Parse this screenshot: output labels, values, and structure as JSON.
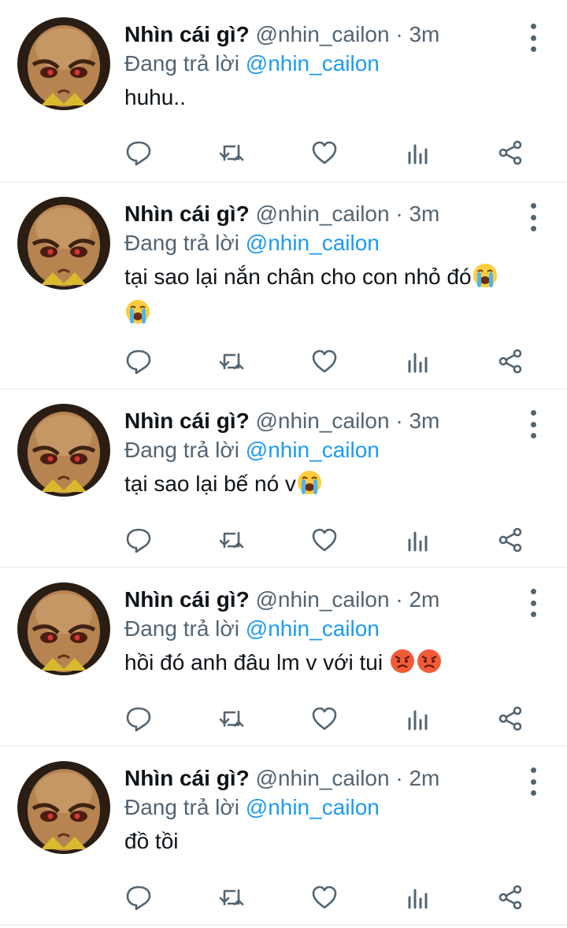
{
  "tweets": [
    {
      "name": "Nhìn cái gì?",
      "handle": "@nhin_cailon",
      "separator": "·",
      "time": "3m",
      "reply_prefix": "Đang trả lời",
      "reply_to": "@nhin_cailon",
      "text": "huhu..",
      "emojis": []
    },
    {
      "name": "Nhìn cái gì?",
      "handle": "@nhin_cailon",
      "separator": "·",
      "time": "3m",
      "reply_prefix": "Đang trả lời",
      "reply_to": "@nhin_cailon",
      "text": "tại sao lại nắn chân cho con nhỏ đó",
      "emojis": [
        "loudly-crying-face",
        "loudly-crying-face"
      ]
    },
    {
      "name": "Nhìn cái gì?",
      "handle": "@nhin_cailon",
      "separator": "·",
      "time": "3m",
      "reply_prefix": "Đang trả lời",
      "reply_to": "@nhin_cailon",
      "text": "tại sao lại bế nó v",
      "emojis": [
        "loudly-crying-face"
      ]
    },
    {
      "name": "Nhìn cái gì?",
      "handle": "@nhin_cailon",
      "separator": "·",
      "time": "2m",
      "reply_prefix": "Đang trả lời",
      "reply_to": "@nhin_cailon",
      "text": "hồi đó anh đâu lm v với tui ",
      "emojis": [
        "angry-face",
        "angry-face"
      ]
    },
    {
      "name": "Nhìn cái gì?",
      "handle": "@nhin_cailon",
      "separator": "·",
      "time": "2m",
      "reply_prefix": "Đang trả lời",
      "reply_to": "@nhin_cailon",
      "text": "đồ tồi",
      "emojis": []
    }
  ],
  "actions": [
    "reply-icon",
    "retweet-icon",
    "like-icon",
    "analytics-icon",
    "share-icon"
  ],
  "colors": {
    "text": "#0f1419",
    "secondary": "#536471",
    "link": "#1d9bf0",
    "divider": "#eff3f4"
  }
}
